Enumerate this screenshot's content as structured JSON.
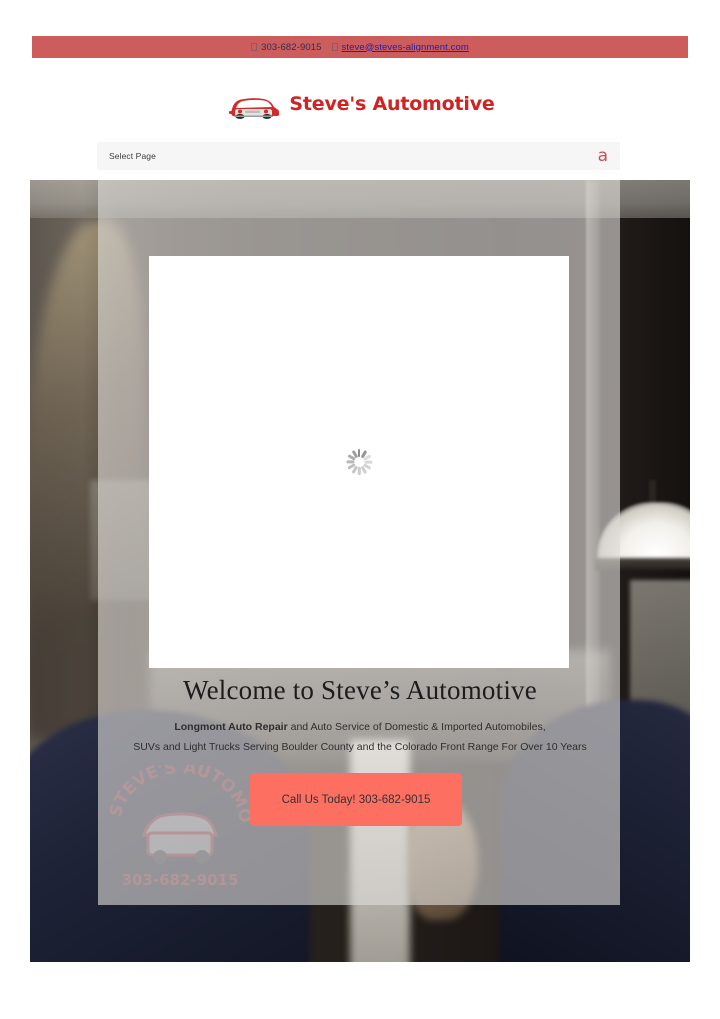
{
  "topbar": {
    "background": "#cd5c5c",
    "phone_icon": "phone-icon",
    "phone": "303-682-9015",
    "email_icon": "envelope-icon",
    "email": "steve@steves-alignment.com"
  },
  "logo": {
    "icon": "classic-car-icon",
    "text": "Steve's Automotive",
    "color": "#d02323"
  },
  "nav": {
    "select_label": "Select Page",
    "menu_icon_glyph": "a",
    "menu_icon_name": "hamburger-menu-icon"
  },
  "hero": {
    "slider_status": "loading",
    "spinner_name": "loading-spinner",
    "heading": "Welcome to Steve’s Automotive",
    "sub_strong": "Longmont Auto Repair",
    "sub_rest": " and Auto Service of Domestic & Imported Automobiles,",
    "sub_line2": "SUVs and Light Trucks Serving Boulder County and the Colorado Front Range For Over 10 Years",
    "cta_label": "Call Us Today! 303-682-9015",
    "cta_color": "#fd6f61",
    "decal_text_top": "STEVE'S AUTOMOTIVE",
    "decal_text_bottom": "303-682-9015"
  }
}
